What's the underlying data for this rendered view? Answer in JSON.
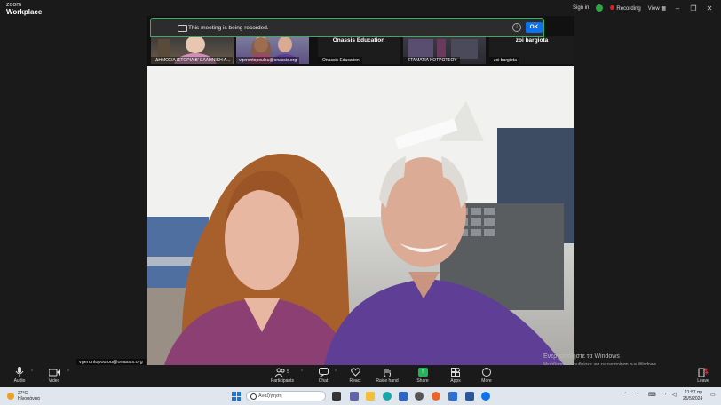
{
  "app": {
    "logo_line1": "zoom",
    "logo_line2": "Workplace"
  },
  "topbar": {
    "signin": "Sign in",
    "recording": "Recording",
    "view": "View"
  },
  "notice": {
    "text": "This meeting is being recorded.",
    "ok": "OK"
  },
  "tiles": [
    {
      "name": "ΔΗΜΟΣΙΑ ΙΣΤΟΡΙΑ Β' ΕΛΛΗΝΙΚΗ Α..."
    },
    {
      "name": "vgerontopoulou@onassis.org"
    },
    {
      "name": "Onassis Education",
      "big": "Onassis Education"
    },
    {
      "name": "ΣΤΑΜΑΤΙΑ ΚΟΤΡΩΤΣΟΥ"
    },
    {
      "name": "zoi bargiota",
      "big": "zoi bargiota"
    }
  ],
  "video": {
    "name": "vgerontopoulou@onassis.org"
  },
  "watermark": {
    "line1": "Ενεργοποιήστε τα Windows",
    "line2": "Μετάβαση στις ρυθμίσεις για ενεργοποίηση των Windows."
  },
  "toolbar": {
    "audio": "Audio",
    "video": "Video",
    "participants": "Participants",
    "participants_count": "5",
    "chat": "Chat",
    "react": "React",
    "raise_hand": "Raise hand",
    "share": "Share",
    "apps": "Apps",
    "more": "More",
    "leave": "Leave"
  },
  "taskbar": {
    "temp": "27°C",
    "weather": "Ηλιοφάνεια",
    "search": "Αναζήτηση",
    "time": "11:57 πμ",
    "date": "25/5/2024"
  },
  "colors": {
    "accent": "#0e72ed",
    "share": "#27b35a",
    "leave": "#e02828",
    "record": "#e02020",
    "active_border": "#2db45e"
  }
}
